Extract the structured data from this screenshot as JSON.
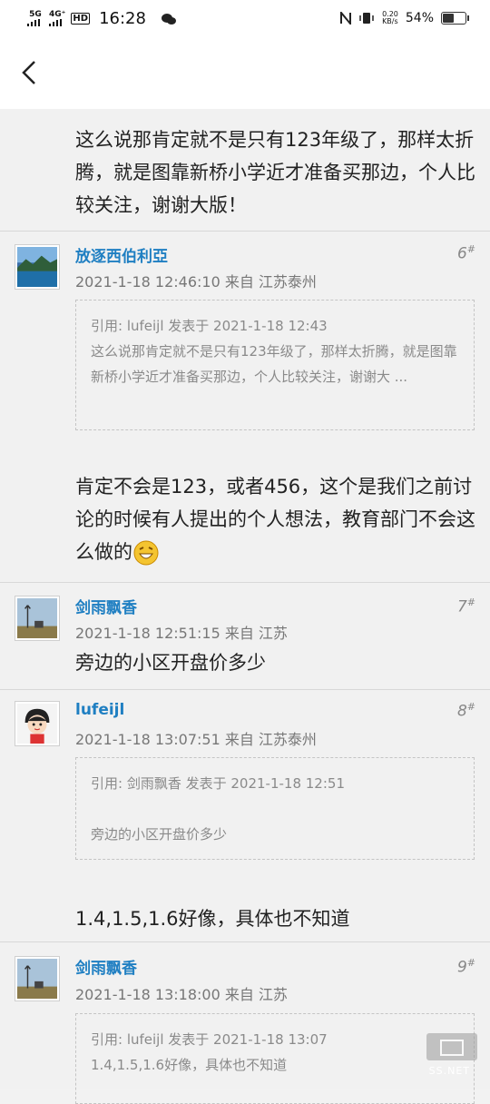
{
  "status_bar": {
    "net1": "5G",
    "net2": "4G⁺",
    "hd": "HD",
    "time": "16:28",
    "speed_value": "0.20",
    "speed_unit": "KB/s",
    "battery": "54%",
    "battery_level": 0.54
  },
  "colors": {
    "author": "#1f7fc2",
    "meta": "#777777",
    "accent_bg": "#f1f1f1"
  },
  "top_post": {
    "body": "这么说那肯定就不是只有123年级了，那样太折腾，就是图靠新桥小学近才准备买那边，个人比较关注，谢谢大版！"
  },
  "posts": [
    {
      "author": "放逐西伯利亞",
      "meta": "2021-1-18 12:46:10 来自 江苏泰州",
      "floor": "6",
      "quote_header": "引用: lufeijl 发表于 2021-1-18 12:43",
      "quote_body": "这么说那肯定就不是只有123年级了，那样太折腾，就是图靠新桥小学近才准备买那边，个人比较关注，谢谢大 ...",
      "body": "肯定不会是123，或者456，这个是我们之前讨论的时候有人提出的个人想法，教育部门不会这么做的",
      "avatar_icon": "landscape-avatar-icon"
    },
    {
      "author": "剑雨飘香",
      "meta": "2021-1-18 12:51:15 来自 江苏",
      "floor": "7",
      "body": "旁边的小区开盘价多少",
      "avatar_icon": "tower-avatar-icon"
    },
    {
      "author": "lufeijl",
      "meta": "2021-1-18 13:07:51 来自 江苏泰州",
      "floor": "8",
      "quote_header": "引用: 剑雨飘香 发表于 2021-1-18 12:51",
      "quote_body": "旁边的小区开盘价多少",
      "body": "1.4,1.5,1.6好像，具体也不知道",
      "avatar_icon": "cartoon-avatar-icon"
    },
    {
      "author": "剑雨飘香",
      "meta": "2021-1-18 13:18:00 来自 江苏",
      "floor": "9",
      "quote_header": "引用: lufeijl 发表于 2021-1-18 13:07",
      "quote_body": "1.4,1.5,1.6好像，具体也不知道",
      "avatar_icon": "tower-avatar-icon"
    }
  ],
  "watermark": "SS.NET"
}
